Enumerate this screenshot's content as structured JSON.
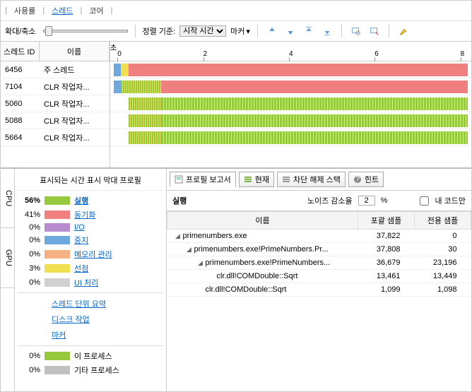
{
  "nav": {
    "usage": "사용률",
    "threads": "스레드",
    "cores": "코어"
  },
  "toolbar": {
    "zoom": "확대/축소",
    "sort_label": "정렬 기준:",
    "sort_value": "시작 시간",
    "marker": "마커"
  },
  "timeline": {
    "unit": "초",
    "ticks": [
      "0",
      "2",
      "4",
      "6",
      "8"
    ],
    "head_id": "스레드 ID",
    "head_name": "이름",
    "threads": [
      {
        "id": "6456",
        "name": "주 스레드"
      },
      {
        "id": "7104",
        "name": "CLR 작업자..."
      },
      {
        "id": "5060",
        "name": "CLR 작업자..."
      },
      {
        "id": "5088",
        "name": "CLR 작업자..."
      },
      {
        "id": "5664",
        "name": "CLR 작업자..."
      }
    ]
  },
  "legend": {
    "title": "표시되는 시간 표시 막대 프로필",
    "vtabs": {
      "cpu": "CPU",
      "gpu": "GPU"
    },
    "items": [
      {
        "pct": "56%",
        "label": "실행",
        "color": "#96c93d",
        "bold": true
      },
      {
        "pct": "41%",
        "label": "동기화",
        "color": "#f08080"
      },
      {
        "pct": "0%",
        "label": "I/O",
        "color": "#b68ccf"
      },
      {
        "pct": "0%",
        "label": "중지",
        "color": "#6fa8dc"
      },
      {
        "pct": "0%",
        "label": "메모리 관리",
        "color": "#f4b183"
      },
      {
        "pct": "3%",
        "label": "선점",
        "color": "#f0e050"
      },
      {
        "pct": "0%",
        "label": "UI 처리",
        "color": "#d0d0d0"
      }
    ],
    "links": [
      "스레드 단위 요약",
      "디스크 작업",
      "마커"
    ],
    "gpu_items": [
      {
        "pct": "0%",
        "label": "이 프로세스",
        "color": "#96c93d"
      },
      {
        "pct": "0%",
        "label": "기타 프로세스",
        "color": "#c0c0c0"
      }
    ]
  },
  "report": {
    "tabs": {
      "profile": "프로필 보고서",
      "current": "현재",
      "unblock": "차단 해제 스택",
      "hint": "힌트"
    },
    "exec_label": "실행",
    "noise_label": "노이즈 감소율",
    "noise_value": "2",
    "pct": "%",
    "mycode": "내 코드만",
    "cols": {
      "name": "이름",
      "inclusive": "포괄 샘플",
      "exclusive": "전용 샘플"
    },
    "rows": [
      {
        "indent": 0,
        "tw": "◢",
        "name": "primenumbers.exe",
        "inc": "37,822",
        "exc": "0"
      },
      {
        "indent": 1,
        "tw": "◢",
        "name": "primenumbers.exe!PrimeNumbers.Pr...",
        "inc": "37,808",
        "exc": "30"
      },
      {
        "indent": 2,
        "tw": "◢",
        "name": "primenumbers.exe!PrimeNumbers...",
        "inc": "36,679",
        "exc": "23,196"
      },
      {
        "indent": 3,
        "tw": "",
        "name": "clr.dll!COMDouble::Sqrt",
        "inc": "13,461",
        "exc": "13,449"
      },
      {
        "indent": 2,
        "tw": "",
        "name": "clr.dll!COMDouble::Sqrt",
        "inc": "1,099",
        "exc": "1,098"
      }
    ]
  }
}
